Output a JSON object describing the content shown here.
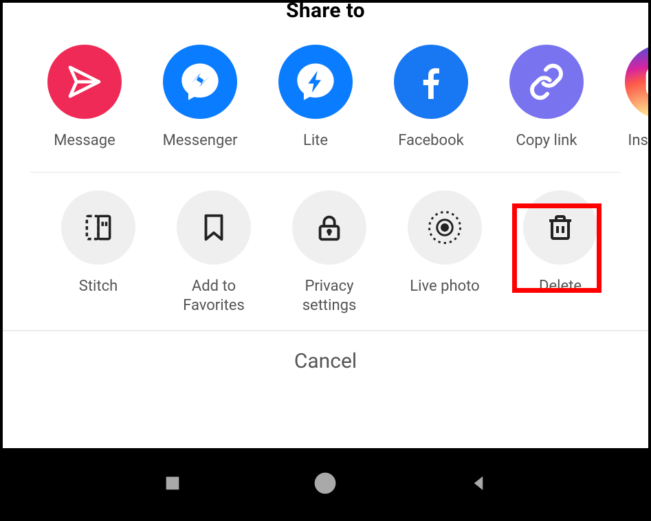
{
  "title": "Share to",
  "share": [
    {
      "label": "Message",
      "icon": "message-icon",
      "color": "#ef2a56"
    },
    {
      "label": "Messenger",
      "icon": "messenger-icon",
      "color": "#0a7cff"
    },
    {
      "label": "Lite",
      "icon": "messenger-lite-icon",
      "color": "#0a7cff"
    },
    {
      "label": "Facebook",
      "icon": "facebook-icon",
      "color": "#1877f2"
    },
    {
      "label": "Copy link",
      "icon": "copy-link-icon",
      "color": "#7973f0"
    },
    {
      "label": "Instagram",
      "icon": "instagram-icon",
      "color": "instagram"
    }
  ],
  "actions": [
    {
      "label": "Stitch",
      "icon": "stitch-icon"
    },
    {
      "label": "Add to\nFavorites",
      "icon": "bookmark-icon"
    },
    {
      "label": "Privacy\nsettings",
      "icon": "lock-icon"
    },
    {
      "label": "Live photo",
      "icon": "live-photo-icon"
    },
    {
      "label": "Delete",
      "icon": "trash-icon"
    }
  ],
  "cancel": "Cancel"
}
